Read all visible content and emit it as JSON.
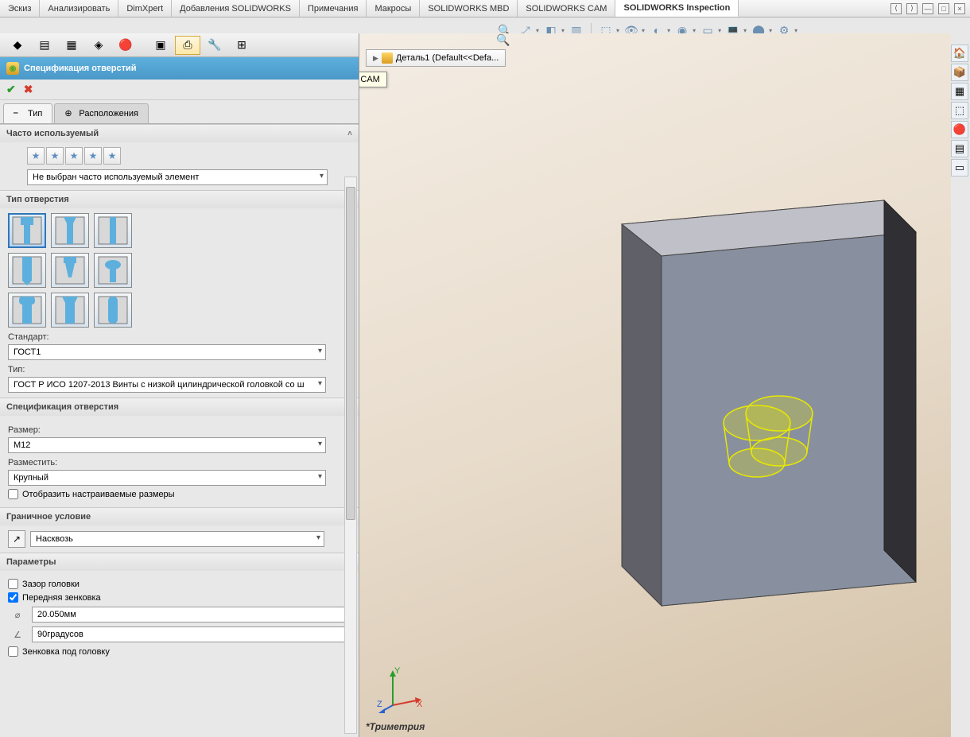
{
  "tabs": [
    "Эскиз",
    "Анализировать",
    "DimXpert",
    "Добавления SOLIDWORKS",
    "Примечания",
    "Макросы",
    "SOLIDWORKS MBD",
    "SOLIDWORKS CAM",
    "SOLIDWORKS Inspection"
  ],
  "active_tab": 8,
  "breadcrumb": "Деталь1 (Default<<Defa...",
  "tooltip": "Дерево операций SOLIDWORKS CAM",
  "pm": {
    "title": "Спецификация отверстий",
    "tabs": {
      "type": "Тип",
      "positions": "Расположения"
    },
    "sections": {
      "favorites": {
        "title": "Часто используемый",
        "combo": "Не выбран часто используемый элемент"
      },
      "hole_type": {
        "title": "Тип отверстия",
        "standard_label": "Стандарт:",
        "standard_value": "ГОСТ1",
        "type_label": "Тип:",
        "type_value": "ГОСТ Р ИСО 1207-2013 Винты с низкой цилиндрической головкой со ш"
      },
      "hole_spec": {
        "title": "Спецификация отверстия",
        "size_label": "Размер:",
        "size_value": "M12",
        "place_label": "Разместить:",
        "place_value": "Крупный",
        "show_custom": "Отобразить настраиваемые размеры"
      },
      "end_cond": {
        "title": "Граничное условие",
        "value": "Насквозь"
      },
      "params": {
        "title": "Параметры",
        "head_clearance": "Зазор головки",
        "front_csk": "Передняя зенковка",
        "diam": "20.050мм",
        "angle": "90градусов",
        "under_head": "Зенковка под головку"
      }
    }
  },
  "view_label": "*Триметрия",
  "triad": {
    "x": "X",
    "y": "Y",
    "z": "Z"
  }
}
